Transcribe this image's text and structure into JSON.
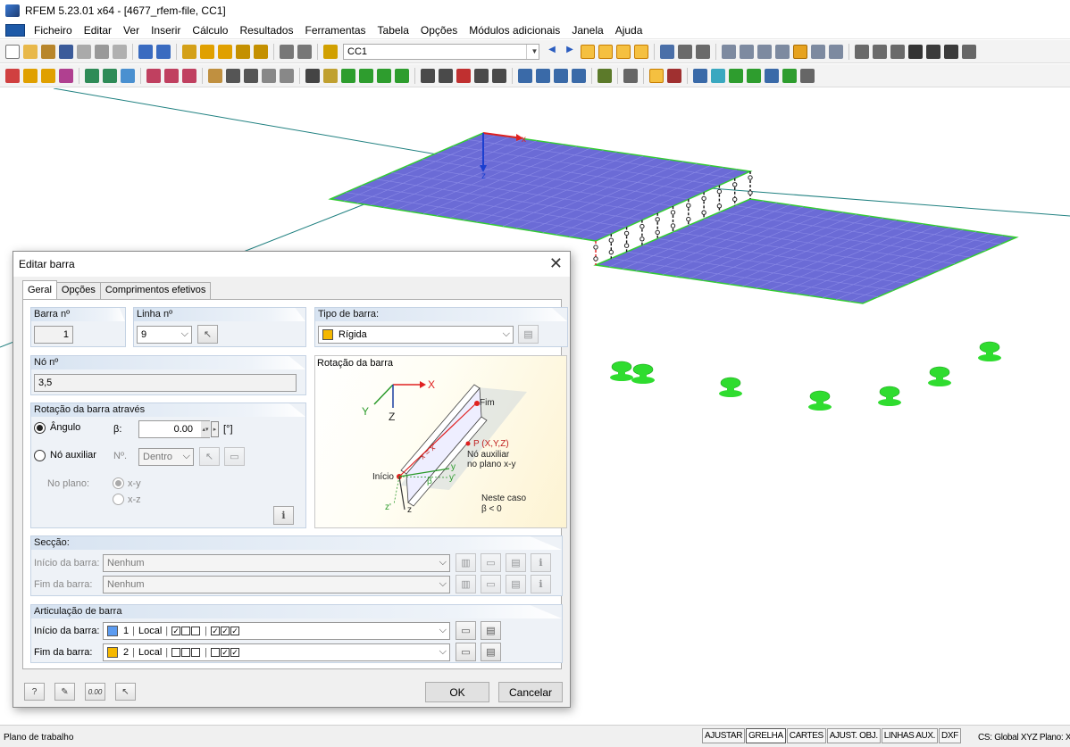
{
  "window": {
    "title": "RFEM 5.23.01 x64 - [4677_rfem-file, CC1]"
  },
  "menu": [
    "Ficheiro",
    "Editar",
    "Ver",
    "Inserir",
    "Cálculo",
    "Resultados",
    "Ferramentas",
    "Tabela",
    "Opções",
    "Módulos adicionais",
    "Janela",
    "Ajuda"
  ],
  "toolbar": {
    "loadcase": "CC1"
  },
  "statusbar": {
    "left": "Plano de trabalho",
    "buttons": [
      "AJUSTAR",
      "GRELHA",
      "CARTES",
      "AJUST. OBJ.",
      "LINHAS AUX.",
      "DXF"
    ],
    "cs": "CS: Global XYZ   Plano: XZ"
  },
  "scene": {
    "slab_color": "#6b6bd6",
    "support_color": "#2fdc2f",
    "axes": {
      "x": "x",
      "z": "z"
    }
  },
  "dialog": {
    "title": "Editar barra",
    "tabs": [
      "Geral",
      "Opções",
      "Comprimentos efetivos"
    ],
    "member_no": {
      "label": "Barra nº",
      "value": "1"
    },
    "line_no": {
      "label": "Linha nº",
      "value": "9"
    },
    "member_type": {
      "label": "Tipo de barra:",
      "value": "Rígida",
      "color": "#f5b800"
    },
    "node_no": {
      "label": "Nó nº",
      "value": "3,5"
    },
    "rotation": {
      "label": "Rotação da barra através",
      "angle_label": "Ângulo",
      "beta_label": "β:",
      "beta_value": "0.00",
      "unit": "[°]",
      "aux_node_label": "Nó auxiliar",
      "aux_no_label": "Nº.",
      "aux_value": "Dentro",
      "plane_label": "No plano:",
      "plane_xy": "x-y",
      "plane_xz": "x-z"
    },
    "rotation_image": {
      "title": "Rotação da barra",
      "labels": {
        "X": "X",
        "Y": "Y",
        "Z": "Z",
        "fim": "Fim",
        "inicio": "Início",
        "p": "P (X,Y,Z)",
        "aux1": "Nó auxiliar",
        "aux2": "no plano x-y",
        "neste": "Neste caso",
        "beta_cond": "β < 0",
        "xp": "x = x'",
        "y": "y",
        "yp": "y'",
        "zp": "z'",
        "z": "z",
        "beta": "β"
      }
    },
    "section": {
      "label": "Secção:",
      "start_label": "Início da barra:",
      "start_value": "Nenhum",
      "end_label": "Fim da barra:",
      "end_value": "Nenhum"
    },
    "hinge": {
      "label": "Articulação de barra",
      "start_label": "Início da barra:",
      "start_no": "1",
      "start_sys": "Local",
      "start_color": "#5b9bf0",
      "end_label": "Fim da barra:",
      "end_no": "2",
      "end_sys": "Local",
      "end_color": "#f5b800"
    },
    "ok": "OK",
    "cancel": "Cancelar",
    "footer_units": "0.00"
  }
}
